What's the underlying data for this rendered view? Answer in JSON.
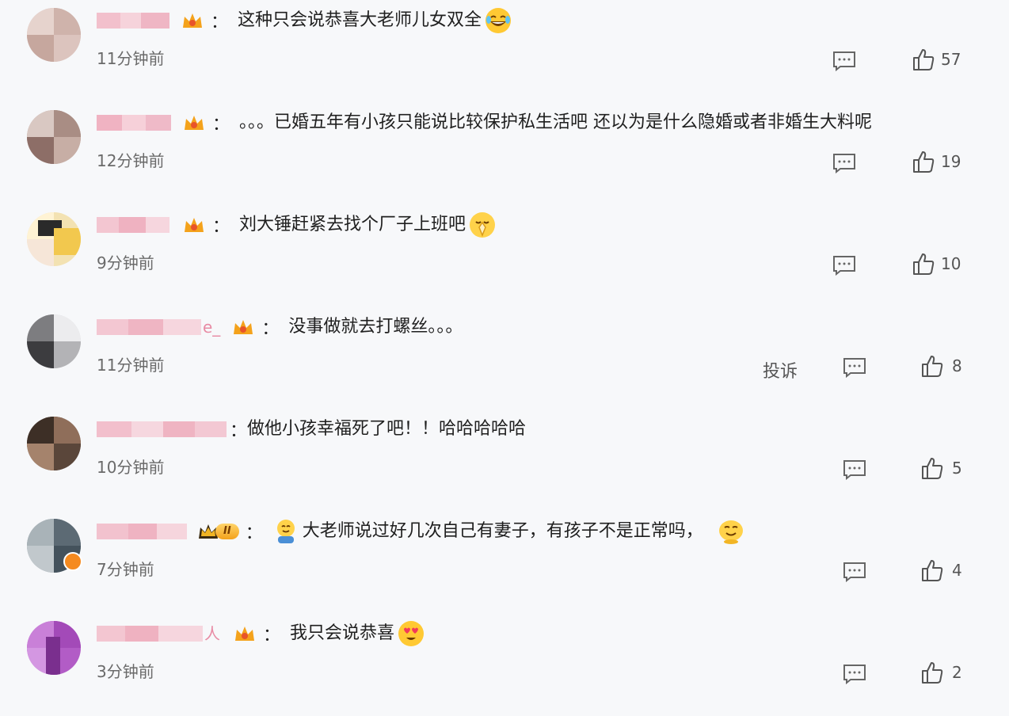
{
  "comments": [
    {
      "name_visible_suffix": "",
      "text": "这种只会说恭喜大老师儿女双全",
      "time": "11分钟前",
      "likes": "57",
      "report": "",
      "emoji": "laugh-tears",
      "emoji_lead": ""
    },
    {
      "name_visible_suffix": "",
      "text": "。。。已婚五年有小孩只能说比较保护私生活吧 还以为是什么隐婚或者非婚生大料呢",
      "time": "12分钟前",
      "likes": "19",
      "report": "",
      "emoji": "",
      "emoji_lead": ""
    },
    {
      "name_visible_suffix": "",
      "text": "刘大锤赶紧去找个厂子上班吧",
      "time": "9分钟前",
      "likes": "10",
      "report": "",
      "emoji": "blessing",
      "emoji_lead": ""
    },
    {
      "name_visible_suffix": "e_",
      "text": "没事做就去打螺丝。。。",
      "time": "11分钟前",
      "likes": "8",
      "report": "投诉",
      "emoji": "",
      "emoji_lead": ""
    },
    {
      "name_visible_suffix": "",
      "text": "做他小孩幸福死了吧！！哈哈哈哈哈",
      "time": "10分钟前",
      "likes": "5",
      "report": "",
      "emoji": "",
      "emoji_lead": ""
    },
    {
      "name_visible_suffix": "",
      "text": "大老师说过好几次自己有妻子，有孩子不是正常吗，",
      "time": "7分钟前",
      "likes": "4",
      "report": "",
      "emoji": "smirk",
      "emoji_lead": "hug"
    },
    {
      "name_visible_suffix": "人",
      "text": "我只会说恭喜",
      "time": "3分钟前",
      "likes": "2",
      "report": "",
      "emoji": "heart-eyes",
      "emoji_lead": ""
    }
  ],
  "badges": {
    "level_label": "II"
  },
  "colon": "：",
  "colors": {
    "vip_crown": "#f4a21b",
    "name_mosaic": "#f0b8c6",
    "text": "#1f1f1f",
    "meta": "#6a6a6a"
  }
}
